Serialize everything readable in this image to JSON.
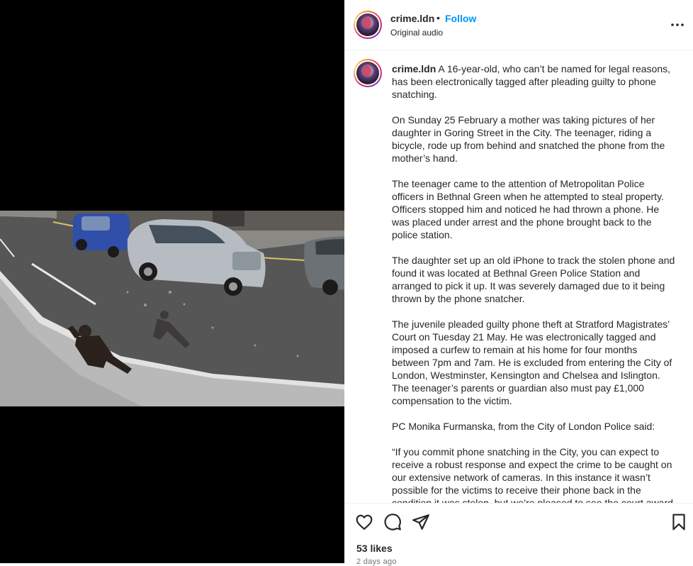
{
  "post": {
    "username": "crime.ldn",
    "dot": "•",
    "follow_label": "Follow",
    "audio_label": "Original audio",
    "caption": {
      "username": "crime.ldn",
      "paragraphs": [
        "A 16-year-old, who can’t be named for legal reasons, has been electronically tagged after pleading guilty to phone snatching.",
        "On Sunday 25 February a mother was taking pictures of her daughter in Goring Street in the City. The teenager, riding a bicycle, rode up from behind and snatched the phone from the mother’s hand.",
        "The teenager came to the attention of Metropolitan Police officers in Bethnal Green when he attempted to steal property. Officers stopped him and noticed he had thrown a phone. He was placed under arrest and the phone brought back to the police station.",
        "The daughter set up an old iPhone to track the stolen phone and found it was located at Bethnal Green Police Station and arranged to pick it up. It was severely damaged due to it being thrown by the phone snatcher.",
        "The juvenile pleaded guilty phone theft at Stratford Magistrates’ Court on Tuesday 21 May. He was electronically tagged and imposed a curfew to remain at his home for four months between 7pm and 7am. He is excluded from entering the City of London, Westminster, Kensington and Chelsea and Islington. The teenager’s parents or guardian also must pay £1,000 compensation to the victim.",
        "PC Monika Furmanska, from the City of London Police said:",
        "“If you commit phone snatching in the City, you can expect to receive a robust response and expect the crime to be caught on our extensive network of cameras. In this instance it wasn’t possible for the victims to receive their phone back in the condition it was stolen, but we’re pleased to see the court award"
      ]
    },
    "likes": "53 likes",
    "time": "2 days ago"
  },
  "icons": {
    "more": "more-options-icon",
    "like": "heart-icon",
    "comment": "comment-icon",
    "share": "share-icon",
    "save": "bookmark-icon"
  },
  "colors": {
    "accent": "#0095f6",
    "text": "#262626",
    "muted": "#737373",
    "divider": "#efefef",
    "media_bg": "#000000"
  }
}
